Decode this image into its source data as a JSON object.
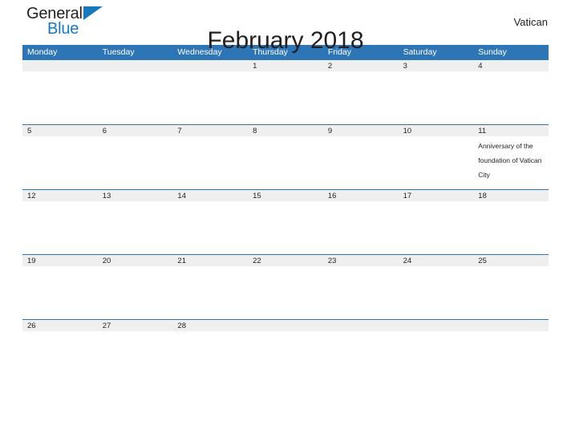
{
  "brand": {
    "name_part1": "General",
    "name_part2": "Blue",
    "flag_icon": "triangle-flag-icon",
    "accent_color": "#1878be"
  },
  "header": {
    "title": "February 2018",
    "region": "Vatican"
  },
  "theme": {
    "header_blue": "#2e75b6",
    "row_gray": "#efefef",
    "text_dark": "#231f20",
    "page_background": "#ffffff"
  },
  "calendar": {
    "month": "February",
    "year": "2018",
    "weekday_headers": [
      "Monday",
      "Tuesday",
      "Wednesday",
      "Thursday",
      "Friday",
      "Saturday",
      "Sunday"
    ],
    "weeks": [
      {
        "days": [
          {
            "number": "",
            "event": ""
          },
          {
            "number": "",
            "event": ""
          },
          {
            "number": "",
            "event": ""
          },
          {
            "number": "1",
            "event": ""
          },
          {
            "number": "2",
            "event": ""
          },
          {
            "number": "3",
            "event": ""
          },
          {
            "number": "4",
            "event": ""
          }
        ]
      },
      {
        "days": [
          {
            "number": "5",
            "event": ""
          },
          {
            "number": "6",
            "event": ""
          },
          {
            "number": "7",
            "event": ""
          },
          {
            "number": "8",
            "event": ""
          },
          {
            "number": "9",
            "event": ""
          },
          {
            "number": "10",
            "event": ""
          },
          {
            "number": "11",
            "event": "Anniversary of the foundation of Vatican City"
          }
        ]
      },
      {
        "days": [
          {
            "number": "12",
            "event": ""
          },
          {
            "number": "13",
            "event": ""
          },
          {
            "number": "14",
            "event": ""
          },
          {
            "number": "15",
            "event": ""
          },
          {
            "number": "16",
            "event": ""
          },
          {
            "number": "17",
            "event": ""
          },
          {
            "number": "18",
            "event": ""
          }
        ]
      },
      {
        "days": [
          {
            "number": "19",
            "event": ""
          },
          {
            "number": "20",
            "event": ""
          },
          {
            "number": "21",
            "event": ""
          },
          {
            "number": "22",
            "event": ""
          },
          {
            "number": "23",
            "event": ""
          },
          {
            "number": "24",
            "event": ""
          },
          {
            "number": "25",
            "event": ""
          }
        ]
      },
      {
        "days": [
          {
            "number": "26",
            "event": ""
          },
          {
            "number": "27",
            "event": ""
          },
          {
            "number": "28",
            "event": ""
          },
          {
            "number": "",
            "event": ""
          },
          {
            "number": "",
            "event": ""
          },
          {
            "number": "",
            "event": ""
          },
          {
            "number": "",
            "event": ""
          }
        ]
      }
    ]
  }
}
